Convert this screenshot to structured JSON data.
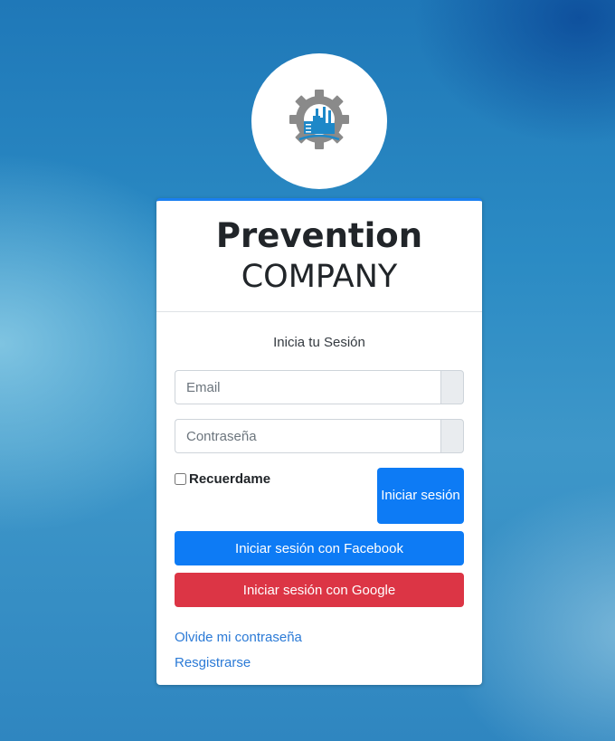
{
  "brand": {
    "name_bold": "Prevention",
    "name_light": "COMPANY"
  },
  "login": {
    "message": "Inicia tu Sesión",
    "email_placeholder": "Email",
    "password_placeholder": "Contraseña",
    "remember_label": "Recuerdame",
    "signin_label": "Iniciar sesión",
    "facebook_label": "Iniciar sesión con Facebook",
    "google_label": "Iniciar sesión con Google",
    "forgot_link": "Olvide mi contraseña",
    "register_link": "Resgistrarse"
  },
  "colors": {
    "primary": "#0d7bf5",
    "danger": "#dc3545",
    "link": "#2b7ad6",
    "logo_gear": "#8a8a8a",
    "logo_factory": "#1e88c8"
  },
  "icons": {
    "logo": "gear-factory-logo-icon"
  }
}
